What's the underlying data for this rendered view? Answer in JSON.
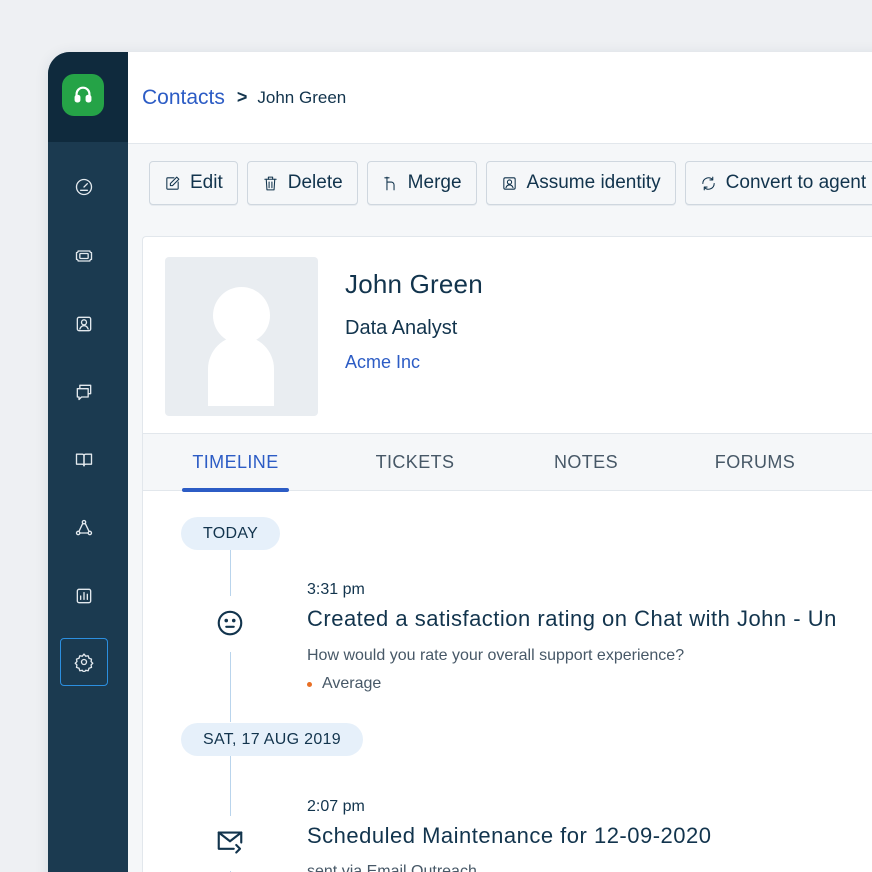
{
  "breadcrumb": {
    "parent": "Contacts",
    "separator": ">",
    "current": "John Green"
  },
  "toolbar": {
    "edit": "Edit",
    "delete": "Delete",
    "merge": "Merge",
    "assume_identity": "Assume identity",
    "convert": "Convert to agent"
  },
  "profile": {
    "name": "John Green",
    "title": "Data Analyst",
    "company": "Acme Inc"
  },
  "tabs": [
    "TIMELINE",
    "TICKETS",
    "NOTES",
    "FORUMS"
  ],
  "active_tab": "TIMELINE",
  "timeline": {
    "groups": [
      {
        "date": "TODAY",
        "event": {
          "icon": "smiley-icon",
          "time": "3:31 pm",
          "title": "Created a satisfaction rating on Chat with John - Un",
          "description": "How would you rate your overall support experience?",
          "rating": "Average"
        }
      },
      {
        "date": "SAT, 17 AUG 2019",
        "event": {
          "icon": "mail-icon",
          "time": "2:07 pm",
          "title": "Scheduled Maintenance for 12-09-2020",
          "description": "sent via Email Outreach"
        }
      }
    ]
  },
  "sidebar": {
    "items": [
      "dashboard-icon",
      "tickets-icon",
      "contacts-icon",
      "conversations-icon",
      "knowledge-base-icon",
      "network-icon",
      "reports-icon",
      "settings-icon"
    ],
    "active": "settings-icon"
  },
  "colors": {
    "brand_green": "#25a347",
    "sidebar": "#1b3a50",
    "accent": "#2c5cc5",
    "rating_dot": "#e86f25"
  }
}
